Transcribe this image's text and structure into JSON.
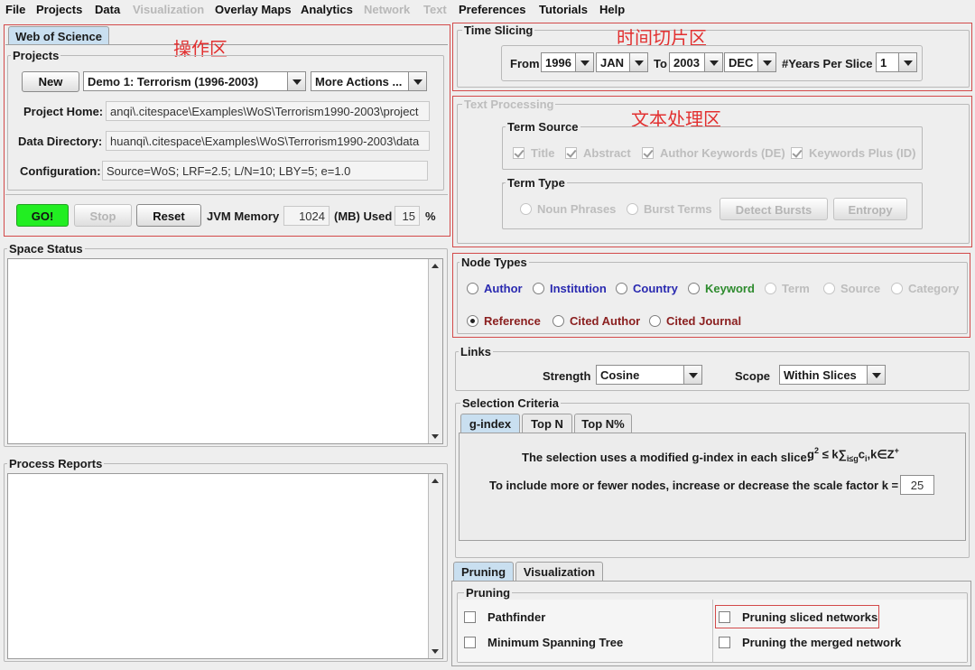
{
  "menu": [
    {
      "label": "File",
      "enabled": true
    },
    {
      "label": "Projects",
      "enabled": true
    },
    {
      "label": "Data",
      "enabled": true
    },
    {
      "label": "Visualization",
      "enabled": false
    },
    {
      "label": "Overlay Maps",
      "enabled": true
    },
    {
      "label": "Analytics",
      "enabled": true
    },
    {
      "label": "Network",
      "enabled": false
    },
    {
      "label": "Text",
      "enabled": false
    },
    {
      "label": "Preferences",
      "enabled": true
    },
    {
      "label": "Tutorials",
      "enabled": true
    },
    {
      "label": "Help",
      "enabled": true
    }
  ],
  "annotations": {
    "operations": "操作区",
    "time_slicing": "时间切片区",
    "text_processing": "文本处理区"
  },
  "source_tab": "Web of Science",
  "projects": {
    "legend": "Projects",
    "new_label": "New",
    "project_selected": "Demo 1: Terrorism (1996-2003)",
    "more_actions": "More Actions ...",
    "home_label": "Project Home:",
    "home_value": "anqi\\.citespace\\Examples\\WoS\\Terrorism1990-2003\\project",
    "data_dir_label": "Data Directory:",
    "data_dir_value": "huanqi\\.citespace\\Examples\\WoS\\Terrorism1990-2003\\data",
    "config_label": "Configuration:",
    "config_value": "Source=WoS; LRF=2.5; L/N=10; LBY=5; e=1.0"
  },
  "run": {
    "go": "GO!",
    "stop": "Stop",
    "reset": "Reset",
    "jvm_label": "JVM Memory",
    "jvm_value": "1024",
    "mb_used_label": "(MB) Used",
    "used_value": "15",
    "percent": "%"
  },
  "space_status": {
    "legend": "Space Status"
  },
  "process_reports": {
    "legend": "Process Reports"
  },
  "time_slicing": {
    "legend": "Time Slicing",
    "from_label": "From",
    "from_year": "1996",
    "from_month": "JAN",
    "to_label": "To",
    "to_year": "2003",
    "to_month": "DEC",
    "years_per_slice_label": "#Years Per Slice",
    "years_per_slice": "1"
  },
  "text_processing": {
    "legend": "Text Processing",
    "term_source_legend": "Term Source",
    "sources": [
      "Title",
      "Abstract",
      "Author Keywords (DE)",
      "Keywords Plus (ID)"
    ],
    "term_type_legend": "Term Type",
    "noun_phrases": "Noun Phrases",
    "burst_terms": "Burst Terms",
    "detect_bursts": "Detect Bursts",
    "entropy": "Entropy"
  },
  "node_types": {
    "legend": "Node Types",
    "row1": [
      {
        "label": "Author",
        "color": "#2a2ab0"
      },
      {
        "label": "Institution",
        "color": "#2a2ab0"
      },
      {
        "label": "Country",
        "color": "#2a2ab0"
      },
      {
        "label": "Keyword",
        "color": "#2e8b2e"
      },
      {
        "label": "Term",
        "color": "#bdbdbd"
      },
      {
        "label": "Source",
        "color": "#bdbdbd"
      },
      {
        "label": "Category",
        "color": "#bdbdbd"
      }
    ],
    "row2": [
      {
        "label": "Reference",
        "color": "#8b2020",
        "selected": true
      },
      {
        "label": "Cited Author",
        "color": "#8b2020"
      },
      {
        "label": "Cited Journal",
        "color": "#8b2020"
      }
    ]
  },
  "links": {
    "legend": "Links",
    "strength_label": "Strength",
    "strength_value": "Cosine",
    "scope_label": "Scope",
    "scope_value": "Within Slices"
  },
  "selection_criteria": {
    "legend": "Selection Criteria",
    "tabs": [
      "g-index",
      "Top N",
      "Top N%"
    ],
    "description": "The selection uses a modified g-index in each slice:",
    "scale_text": "To include more or fewer nodes, increase or decrease the scale factor k =",
    "k_value": "25"
  },
  "bottom_tabs": [
    "Pruning",
    "Visualization"
  ],
  "pruning": {
    "legend": "Pruning",
    "pathfinder": "Pathfinder",
    "mst": "Minimum Spanning Tree",
    "sliced": "Pruning sliced networks",
    "merged": "Pruning the merged network"
  }
}
